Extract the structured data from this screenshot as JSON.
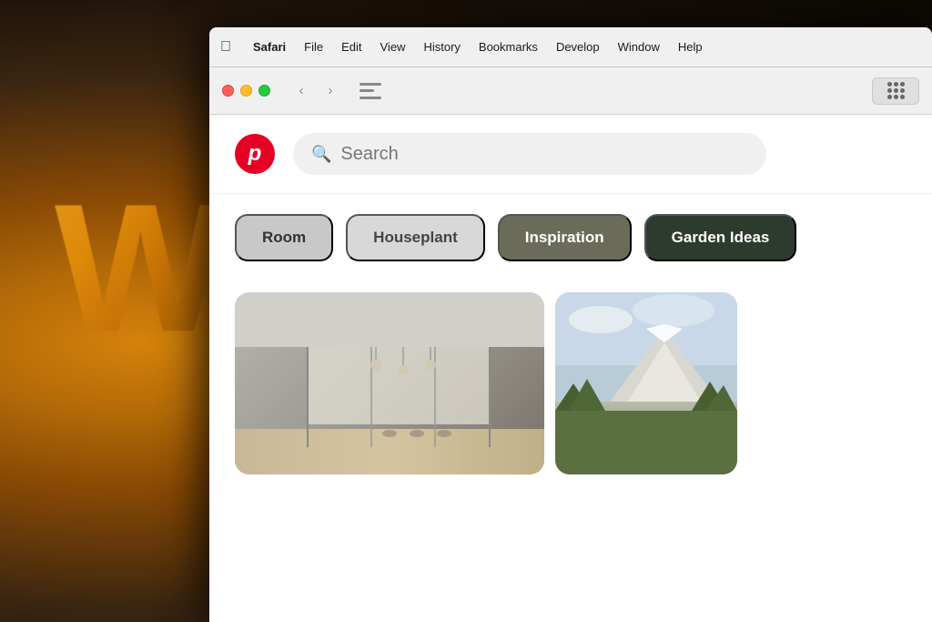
{
  "background": {
    "letter": "W"
  },
  "menubar": {
    "apple": "⌘",
    "items": [
      {
        "id": "safari",
        "label": "Safari",
        "bold": true
      },
      {
        "id": "file",
        "label": "File",
        "bold": false
      },
      {
        "id": "edit",
        "label": "Edit",
        "bold": false
      },
      {
        "id": "view",
        "label": "View",
        "bold": false
      },
      {
        "id": "history",
        "label": "History",
        "bold": false
      },
      {
        "id": "bookmarks",
        "label": "Bookmarks",
        "bold": false
      },
      {
        "id": "develop",
        "label": "Develop",
        "bold": false
      },
      {
        "id": "window",
        "label": "Window",
        "bold": false
      },
      {
        "id": "help",
        "label": "Help",
        "bold": false
      }
    ]
  },
  "browser": {
    "traffic_lights": [
      "red",
      "yellow",
      "green"
    ],
    "back_arrow": "‹",
    "forward_arrow": "›"
  },
  "pinterest": {
    "logo_letter": "p",
    "search_placeholder": "Search"
  },
  "categories": [
    {
      "id": "room",
      "label": "Room",
      "style": "room"
    },
    {
      "id": "houseplant",
      "label": "Houseplant",
      "style": "houseplant"
    },
    {
      "id": "inspiration",
      "label": "Inspiration",
      "style": "inspiration"
    },
    {
      "id": "garden-ideas",
      "label": "Garden Ideas",
      "style": "garden-ideas"
    }
  ]
}
